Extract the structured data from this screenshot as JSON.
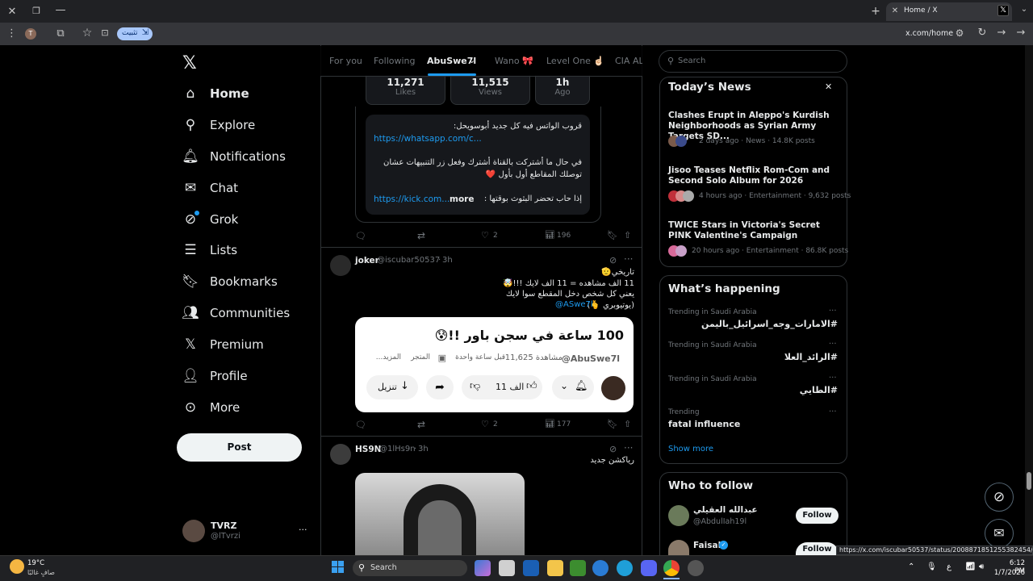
{
  "browser": {
    "tab_title": "Home / X",
    "url": "x.com/home",
    "install_label": "تثبيت"
  },
  "sidebar": {
    "items": [
      {
        "label": "Home",
        "icon": "home-icon"
      },
      {
        "label": "Explore",
        "icon": "search-icon"
      },
      {
        "label": "Notifications",
        "icon": "bell-icon"
      },
      {
        "label": "Chat",
        "icon": "mail-icon"
      },
      {
        "label": "Grok",
        "icon": "grok-icon"
      },
      {
        "label": "Lists",
        "icon": "list-icon"
      },
      {
        "label": "Bookmarks",
        "icon": "bookmark-icon"
      },
      {
        "label": "Communities",
        "icon": "people-icon"
      },
      {
        "label": "Premium",
        "icon": "x-icon"
      },
      {
        "label": "Profile",
        "icon": "person-icon"
      },
      {
        "label": "More",
        "icon": "more-circle-icon"
      }
    ],
    "post_button": "Post",
    "account": {
      "name": "TVRZ",
      "handle": "@lTvrzi",
      "more": "···"
    }
  },
  "feed_tabs": [
    "For you",
    "Following",
    "AbuSwe7l",
    "Wano 🎀",
    "Level One ☝🏻",
    "CIA ALI"
  ],
  "post1": {
    "stats": [
      {
        "value": "11,271",
        "label": "Likes"
      },
      {
        "value": "11,515",
        "label": "Views"
      },
      {
        "value": "1h",
        "label": "Ago"
      }
    ],
    "text_line1": "قروب الواتس فيه كل جديد أبوسويحل:",
    "link1": "https://whatsapp.com/c...",
    "text_line2": "في حال ما أشتركت بالقناة أشترك وفعل زر التنبيهات عشان",
    "text_line3": "توصلك المقاطع أول بأول ❤️",
    "text_line4": "إذا حاب تحضر البثوث بوقتها :",
    "link2": "https://kick.com...",
    "more": "more",
    "actions": {
      "replies": "",
      "reposts": "",
      "likes": "2",
      "views": "196"
    }
  },
  "post2": {
    "name": "joker",
    "handle": "@iscubar50537",
    "time": "3h",
    "lines": [
      "تاريخي🫡",
      "11 الف مشاهده = 11 الف لايك !!!🤯",
      "يعني كل شخص دخل المقطع سوا لايك",
      "(يوتيوبري 🫰)"
    ],
    "mention": "@ASwe7l",
    "card": {
      "title": "100 ساعة في سجن باور !!😰",
      "channel": "@AbuSwe7l",
      "views": "11,625 مشاهدة",
      "time": "قبل ساعة واحدة",
      "store": "المتجر",
      "more": "...المزيد",
      "likes": "11 الف",
      "download": "تنزيل"
    },
    "actions": {
      "likes": "2",
      "views": "177"
    }
  },
  "post3": {
    "name": "HS9N",
    "handle": "@1lHs9n",
    "time": "3h",
    "text": "رياكشن جديد"
  },
  "search_placeholder": "Search",
  "news": {
    "title": "Today’s News",
    "items": [
      {
        "title": "Clashes Erupt in Aleppo's Kurdish Neighborhoods as Syrian Army Targets SD...",
        "meta": "2 days ago · News · 14.8K posts"
      },
      {
        "title": "Jisoo Teases Netflix Rom-Com and Second Solo Album for 2026",
        "meta": "4 hours ago · Entertainment · 9,632 posts"
      },
      {
        "title": "TWICE Stars in Victoria's Secret PINK Valentine's Campaign",
        "meta": "20 hours ago · Entertainment · 86.8K posts"
      }
    ]
  },
  "happening": {
    "title": "What’s happening",
    "trends": [
      {
        "label": "Trending in Saudi Arabia",
        "title": "#الامارات_وجه_اسرائيل_باليمن"
      },
      {
        "label": "Trending in Saudi Arabia",
        "title": "#الرائد_العلا"
      },
      {
        "label": "Trending in Saudi Arabia",
        "title": "#الطايي"
      },
      {
        "label": "Trending",
        "title": "fatal influence"
      }
    ],
    "show_more": "Show more"
  },
  "who_to_follow": {
    "title": "Who to follow",
    "accounts": [
      {
        "name": "عبدالله العقيلي",
        "handle": "@AbdulIah19l",
        "button": "Follow"
      },
      {
        "name": "Faisal",
        "handle": "",
        "button": "Follow"
      }
    ]
  },
  "status_url": "https://x.com/iscubar50537/status/2008871851255382454/photo/1",
  "taskbar": {
    "weather_temp": "19°C",
    "weather_desc": "صافٍ غالبًا",
    "search": "Search",
    "lang": "ع",
    "time": "6:12 PM",
    "date": "1/7/2026"
  }
}
